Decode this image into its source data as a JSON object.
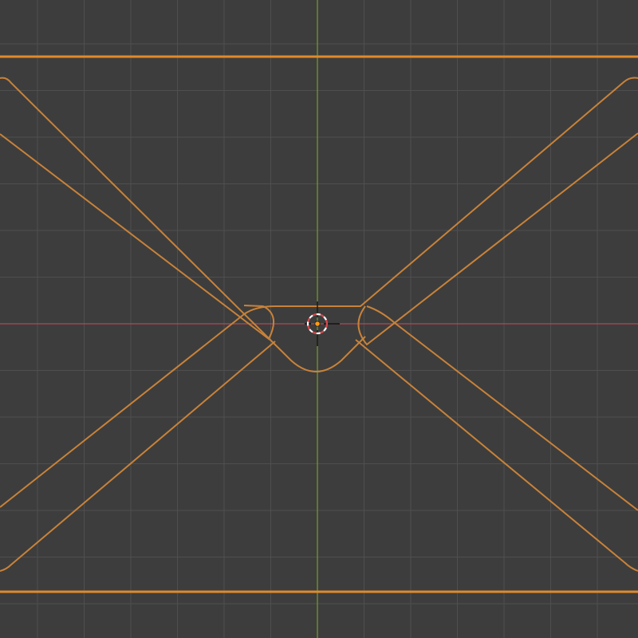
{
  "viewport": {
    "view": "orthographic-front",
    "background_color": "#3d3d3d",
    "grid": {
      "visible": true,
      "line_color": "#4f4f4f"
    },
    "axes": {
      "x_axis_color": "#b34a56",
      "z_axis_color": "#6f9a24"
    },
    "selection": {
      "outline_color": "#c88239",
      "active_edge_color": "#e08a2c"
    },
    "cursor_3d": {
      "icon": "3d-cursor-icon",
      "ring_colors": [
        "#d8494f",
        "#ffffff"
      ]
    },
    "origin": {
      "icon": "object-origin-icon",
      "color": "#ff9a1a"
    }
  }
}
